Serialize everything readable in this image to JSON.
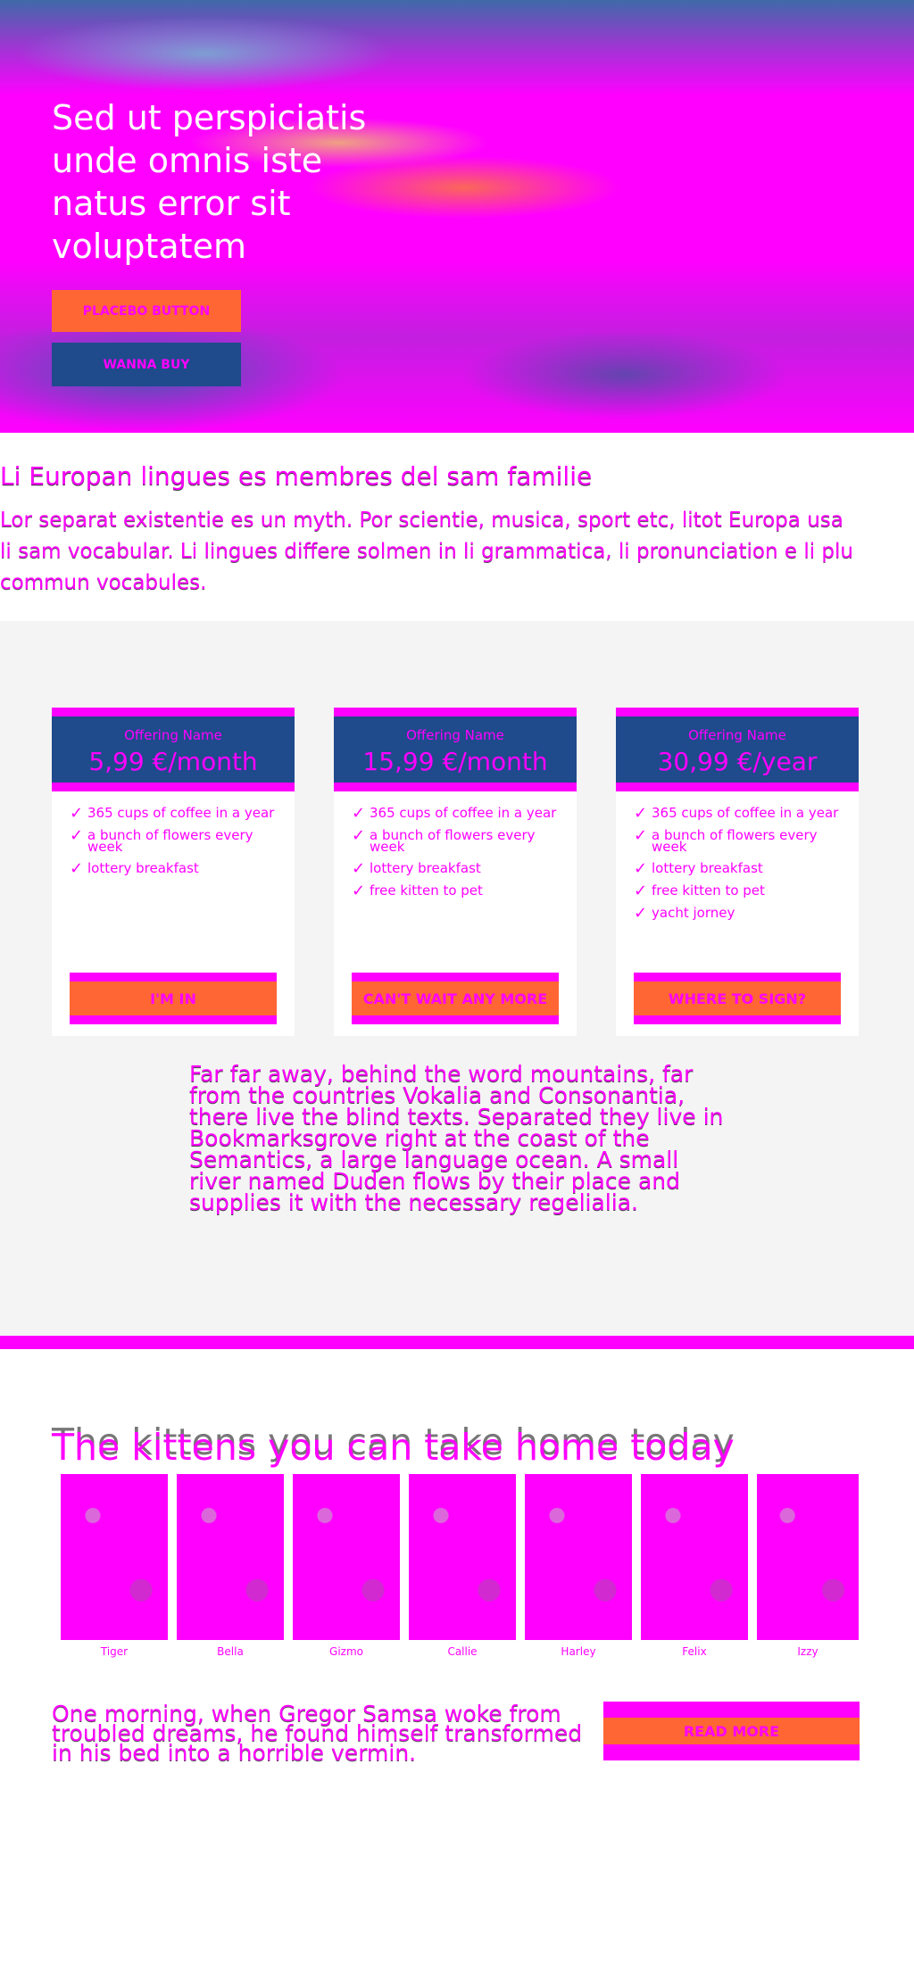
{
  "hero": {
    "title": "Sed ut perspiciatis unde omnis iste natus error sit voluptatem",
    "primary_button": "PLACEBO BUTTON",
    "secondary_button": "WANNA BUY"
  },
  "intro": {
    "heading": "Li Europan lingues es membres del sam familie",
    "text": "Lor separat existentie es un myth. Por scientie, musica, sport etc, litot Europa usa li sam vocabular. Li lingues differe solmen in li grammatica, li pronunciation e li plu commun vocabules."
  },
  "pricing": {
    "cards": [
      {
        "name": "Offering Name",
        "price": "5,99 €/month",
        "features": [
          "365 cups of coffee in a year",
          "a bunch of flowers every week",
          "lottery breakfast"
        ],
        "button": "I'M IN"
      },
      {
        "name": "Offering Name",
        "price": "15,99 €/month",
        "features": [
          "365 cups of coffee in a year",
          "a bunch of flowers every week",
          "lottery breakfast",
          "free kitten to pet"
        ],
        "button": "CAN'T WAIT ANY MORE"
      },
      {
        "name": "Offering Name",
        "price": "30,99 €/year",
        "features": [
          "365 cups of coffee in a year",
          "a bunch of flowers every week",
          "lottery breakfast",
          "free kitten to pet",
          "yacht jorney"
        ],
        "button": "WHERE TO SIGN?"
      }
    ],
    "note": "Far far away, behind the word mountains, far from the countries Vokalia and Consonantia, there live the blind texts. Separated they live in Bookmarksgrove right at the coast of the Semantics, a large language ocean. A small river named Duden flows by their place and supplies it with the necessary regelialia."
  },
  "kittens": {
    "title": "The kittens you can take home today",
    "items": [
      {
        "name": "Tiger"
      },
      {
        "name": "Bella"
      },
      {
        "name": "Gizmo"
      },
      {
        "name": "Callie"
      },
      {
        "name": "Harley"
      },
      {
        "name": "Felix"
      },
      {
        "name": "Izzy"
      }
    ]
  },
  "bottom": {
    "text": "One morning, when Gregor Samsa woke from troubled dreams, he found himself transformed in his bed into a horrible vermin.",
    "button": "READ MORE"
  },
  "colors": {
    "accent": "#ff00ff",
    "button": "#ff6633",
    "navy": "#1f4a8c",
    "section_bg": "#f4f4f4"
  },
  "icons": {
    "feature": "checkmark-icon"
  }
}
